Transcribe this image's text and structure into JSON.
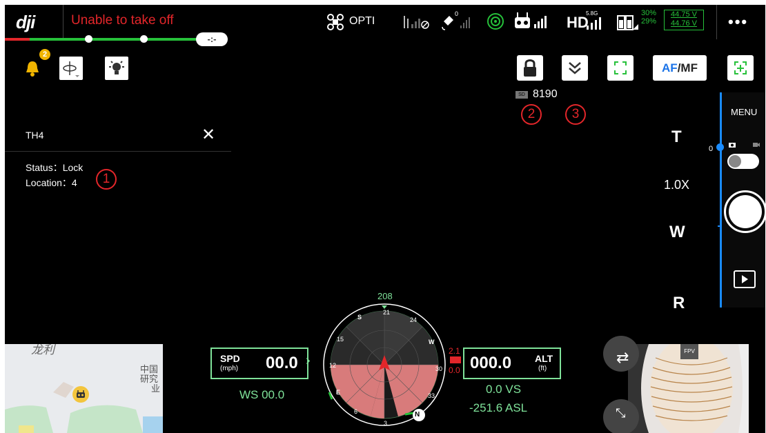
{
  "topbar": {
    "logo": "dji",
    "warning": "Unable to take off",
    "progress_pill": "-:-",
    "mode": "OPTI",
    "gps_count": "0",
    "band": "5.8G",
    "hd_label": "HD",
    "battery_1": "30%",
    "battery_2": "29%",
    "voltage_1": "44.75 V",
    "voltage_2": "44.76 V",
    "more": "•••"
  },
  "left_toolbar": {
    "notification_count": "2"
  },
  "right_toolbar": {
    "af_label": "AF",
    "mf_label": "/MF"
  },
  "storage": {
    "sd_label": "SD",
    "remaining": "8190",
    "marker_2": "②",
    "marker_3": "③"
  },
  "info_panel": {
    "title": "TH4",
    "status": "Status：Lock",
    "location": "Location：4",
    "marker_1": "①"
  },
  "camera_column": {
    "menu": "MENU",
    "tele": "T",
    "zoom": "1.0X",
    "wide": "W",
    "reset": "R",
    "zero": "0"
  },
  "hud": {
    "heading": "208",
    "spd_label": "SPD",
    "spd_unit": "(mph)",
    "spd_value": "00.0",
    "ws": "WS 00.0",
    "alt_label": "ALT",
    "alt_unit": "(ft)",
    "alt_value": "000.0",
    "vs": "0.0  VS",
    "asl": "-251.6 ASL",
    "alt_red_top": "2.1",
    "alt_red_bottom": "0.0",
    "compass": [
      "N",
      "3",
      "6",
      "E",
      "12",
      "15",
      "S",
      "21",
      "24",
      "W",
      "30",
      "33"
    ]
  },
  "map": {
    "text_1": "龙利",
    "text_2": "中国",
    "text_3": "研究",
    "text_4": "业"
  },
  "fpv": {
    "label": "FPV"
  }
}
